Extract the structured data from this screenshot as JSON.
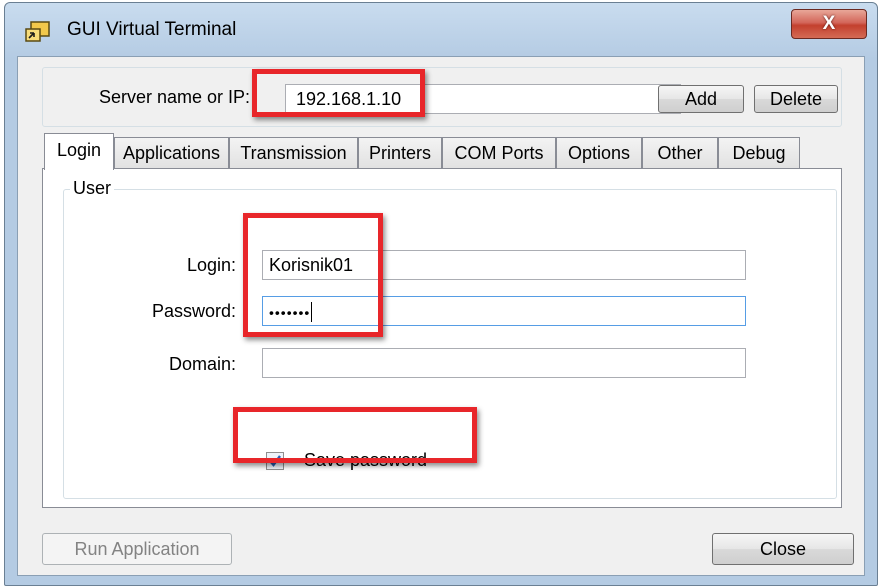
{
  "window": {
    "title": "GUI Virtual Terminal",
    "close_glyph": "X",
    "icon": "terminal-app-icon"
  },
  "server": {
    "label": "Server name or IP:",
    "value": "192.168.1.10",
    "add_label": "Add",
    "delete_label": "Delete"
  },
  "tabs": [
    {
      "label": "Login",
      "active": true
    },
    {
      "label": "Applications",
      "active": false
    },
    {
      "label": "Transmission",
      "active": false
    },
    {
      "label": "Printers",
      "active": false
    },
    {
      "label": "COM Ports",
      "active": false
    },
    {
      "label": "Options",
      "active": false
    },
    {
      "label": "Other",
      "active": false
    },
    {
      "label": "Debug",
      "active": false
    }
  ],
  "login_panel": {
    "group_title": "User",
    "login_label": "Login:",
    "login_value": "Korisnik01",
    "password_label": "Password:",
    "password_value": "•••••••",
    "domain_label": "Domain:",
    "domain_value": "",
    "save_password_label": "Save password",
    "save_password_checked": true
  },
  "footer": {
    "run_label": "Run Application",
    "close_label": "Close"
  },
  "colors": {
    "highlight": "#e8262a",
    "title_bar": "#c9dcef",
    "close_button": "#c3402e"
  }
}
